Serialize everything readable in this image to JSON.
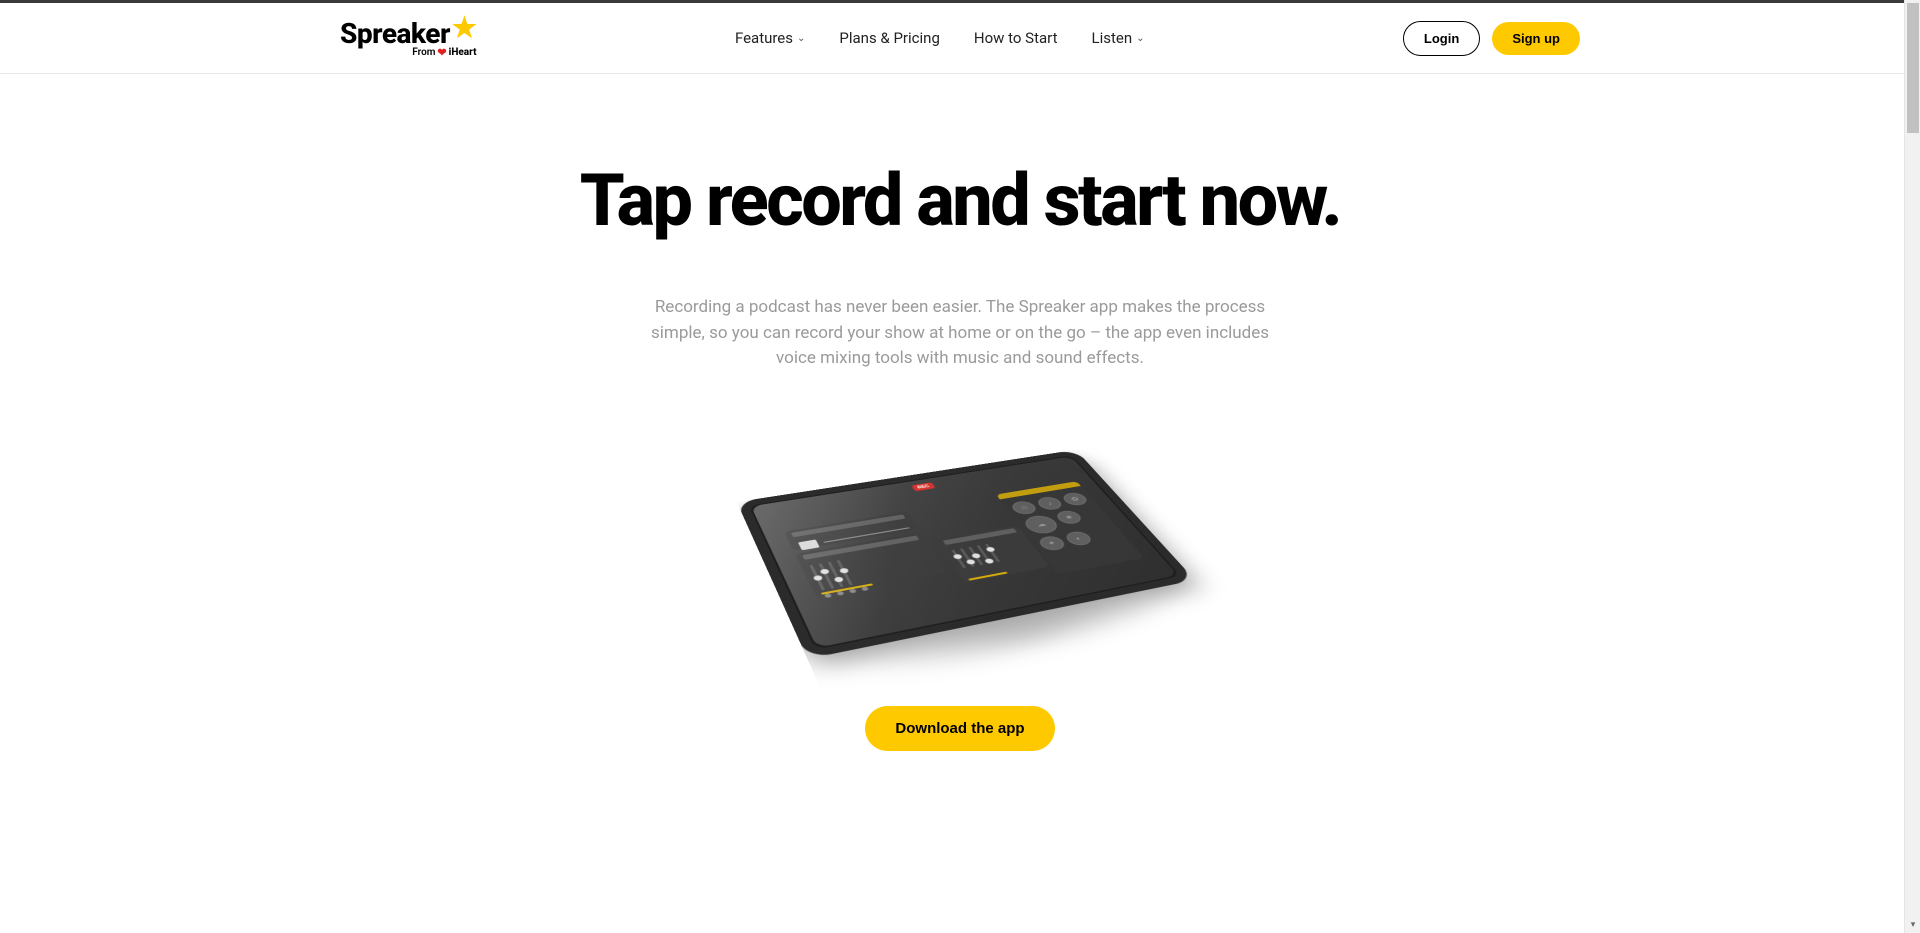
{
  "brand": {
    "name": "Spreaker",
    "subline_prefix": "From",
    "subline_brand": "iHeart"
  },
  "nav": {
    "items": [
      {
        "label": "Features",
        "dropdown": true
      },
      {
        "label": "Plans & Pricing",
        "dropdown": false
      },
      {
        "label": "How to Start",
        "dropdown": false
      },
      {
        "label": "Listen",
        "dropdown": true
      }
    ]
  },
  "auth": {
    "login": "Login",
    "signup": "Sign up"
  },
  "hero": {
    "title": "Tap record and start now.",
    "subtitle": "Recording a podcast has never been easier. The Spreaker app makes the process simple, so you can record your show at home or on the go – the app even includes voice mixing tools with music and sound effects."
  },
  "tablet": {
    "rec_label": "REC"
  },
  "cta": {
    "download": "Download the app"
  },
  "colors": {
    "accent": "#ffc900",
    "text_muted": "#9a9a9a"
  }
}
